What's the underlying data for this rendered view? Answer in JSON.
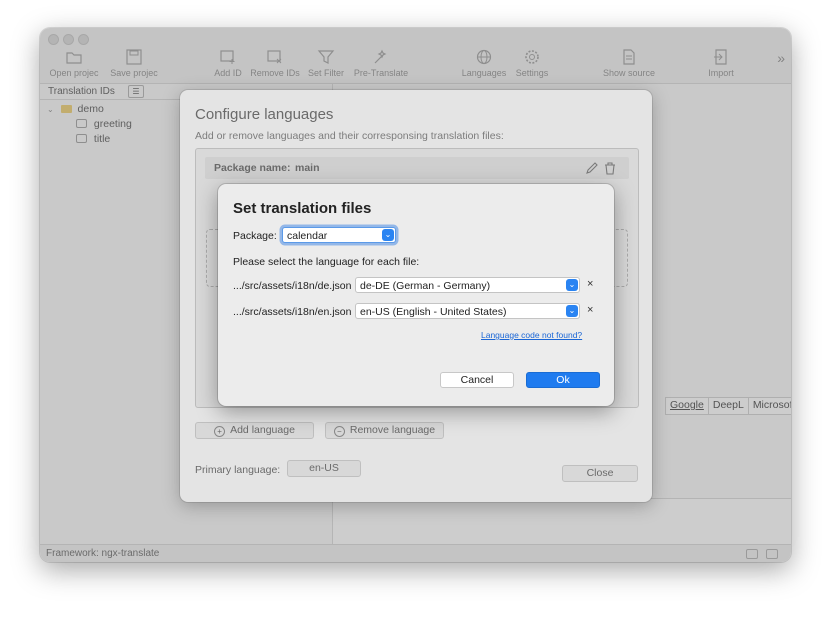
{
  "toolbar": {
    "items": [
      {
        "label": "Open projec",
        "icon": "folder-icon"
      },
      {
        "label": "Save projec",
        "icon": "save-icon"
      },
      {
        "label": "Add ID",
        "icon": "add-id-icon"
      },
      {
        "label": "Remove IDs",
        "icon": "remove-ids-icon"
      },
      {
        "label": "Set Filter",
        "icon": "filter-icon"
      },
      {
        "label": "Pre-Translate",
        "icon": "magic-wand-icon"
      },
      {
        "label": "Languages",
        "icon": "globe-icon"
      },
      {
        "label": "Settings",
        "icon": "gear-icon"
      },
      {
        "label": "Show source",
        "icon": "document-icon"
      },
      {
        "label": "Import",
        "icon": "import-icon"
      }
    ],
    "more": "»"
  },
  "sidebar": {
    "header": "Translation IDs",
    "tree": [
      {
        "label": "demo",
        "icon": "folder-icon"
      },
      {
        "label": "greeting",
        "icon": "message-icon"
      },
      {
        "label": "title",
        "icon": "message-icon"
      }
    ]
  },
  "providers": [
    "Google",
    "DeepL",
    "Microsoft"
  ],
  "status": {
    "framework": "Framework: ngx-translate"
  },
  "config_dialog": {
    "title": "Configure languages",
    "subtitle": "Add or remove languages and their corresponsing translation files:",
    "package_label": "Package name:",
    "package_value": "main",
    "add_language": "Add language",
    "remove_language": "Remove language",
    "primary_label": "Primary language:",
    "primary_value": "en-US",
    "close": "Close"
  },
  "modal": {
    "title": "Set translation files",
    "package_label": "Package:",
    "package_value": "calendar",
    "instruction": "Please select the language for each file:",
    "files": [
      {
        "path": ".../src/assets/i18n/de.json",
        "language": "de-DE (German - Germany)"
      },
      {
        "path": ".../src/assets/i18n/en.json",
        "language": "en-US (English - United States)"
      }
    ],
    "clear_symbol": "×",
    "link": "Language code not found?",
    "cancel": "Cancel",
    "ok": "Ok",
    "accent_color": "#1f7bef"
  }
}
